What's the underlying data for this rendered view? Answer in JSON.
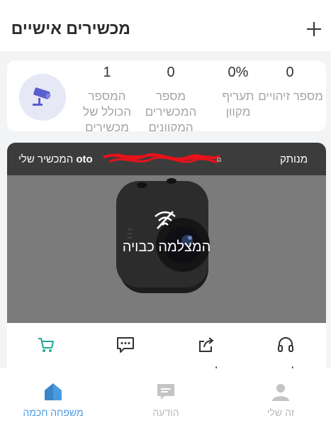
{
  "header": {
    "title": "מכשירים אישיים",
    "add_icon": "plus-icon"
  },
  "stats": [
    {
      "value": "0",
      "label": "מספר זיהויים"
    },
    {
      "value": "0%",
      "label": "תעריף מקוון"
    },
    {
      "value": "0",
      "label": "מספר המכשירים המקוונים"
    },
    {
      "value": "1",
      "label": "המספר הכולל של מכשירים"
    }
  ],
  "device": {
    "status": "מנותק",
    "name_prefix": "oto",
    "name_suffix": " המכשיר שלי",
    "offline_label": "המצלמה כבויה",
    "redaction_color": "#e8121a"
  },
  "actions": [
    {
      "icon": "headset-icon",
      "label": "לבית"
    },
    {
      "icon": "share-icon",
      "label": "לשתף"
    },
    {
      "icon": "message-icon",
      "label": "הודעה"
    },
    {
      "icon": "cart-icon",
      "label": "שירותי ענן"
    }
  ],
  "tabs": [
    {
      "icon": "user-icon",
      "label": "זה שלי",
      "active": false
    },
    {
      "icon": "message-icon",
      "label": "הודעה",
      "active": false
    },
    {
      "icon": "home-icon",
      "label": "משפחה חכמה",
      "active": true
    }
  ],
  "colors": {
    "accent": "#4a9ae0",
    "cart": "#26a89a",
    "header_bar": "#3c3c3c",
    "preview_bg": "#7b7b7b"
  }
}
